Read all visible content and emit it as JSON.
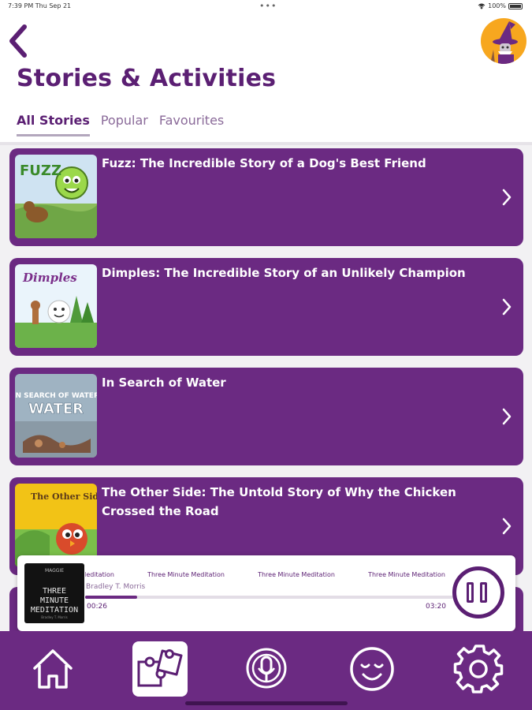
{
  "status_bar": {
    "time_date": "7:39 PM  Thu Sep 21",
    "battery": "100%"
  },
  "header": {
    "title": "Stories & Activities"
  },
  "tabs": [
    {
      "label": "All Stories"
    },
    {
      "label": "Popular"
    },
    {
      "label": "Favourites"
    }
  ],
  "stories": [
    {
      "title": "Fuzz: The Incredible Story of a Dog's Best Friend",
      "cover_text": "FUZZ"
    },
    {
      "title": "Dimples: The Incredible Story of an Unlikely Champion",
      "cover_text": "Dimples"
    },
    {
      "title": "In Search of Water",
      "cover_text": "IN SEARCH OF WATER"
    },
    {
      "title": "The Other Side: The Untold Story of Why the Chicken Crossed the Road",
      "cover_text": "The Other Side"
    }
  ],
  "player": {
    "art_publisher": "MAGGIE",
    "art_title": "THREE MINUTE MEDITATION",
    "art_subtitle": "Bradley T. Morris",
    "marquee_text": "Three Minute Meditation",
    "artist": "Bradley T. Morris",
    "current_time": "00:26",
    "total_time": "03:20",
    "progress": 0.14
  },
  "nav": [
    {
      "icon": "home-icon"
    },
    {
      "icon": "puzzle-icon"
    },
    {
      "icon": "podcast-mic-icon"
    },
    {
      "icon": "calm-face-icon"
    },
    {
      "icon": "gear-icon"
    }
  ],
  "colors": {
    "brand_purple": "#6b2a82",
    "title_purple": "#5b1f73",
    "avatar_orange": "#f7a71f"
  }
}
